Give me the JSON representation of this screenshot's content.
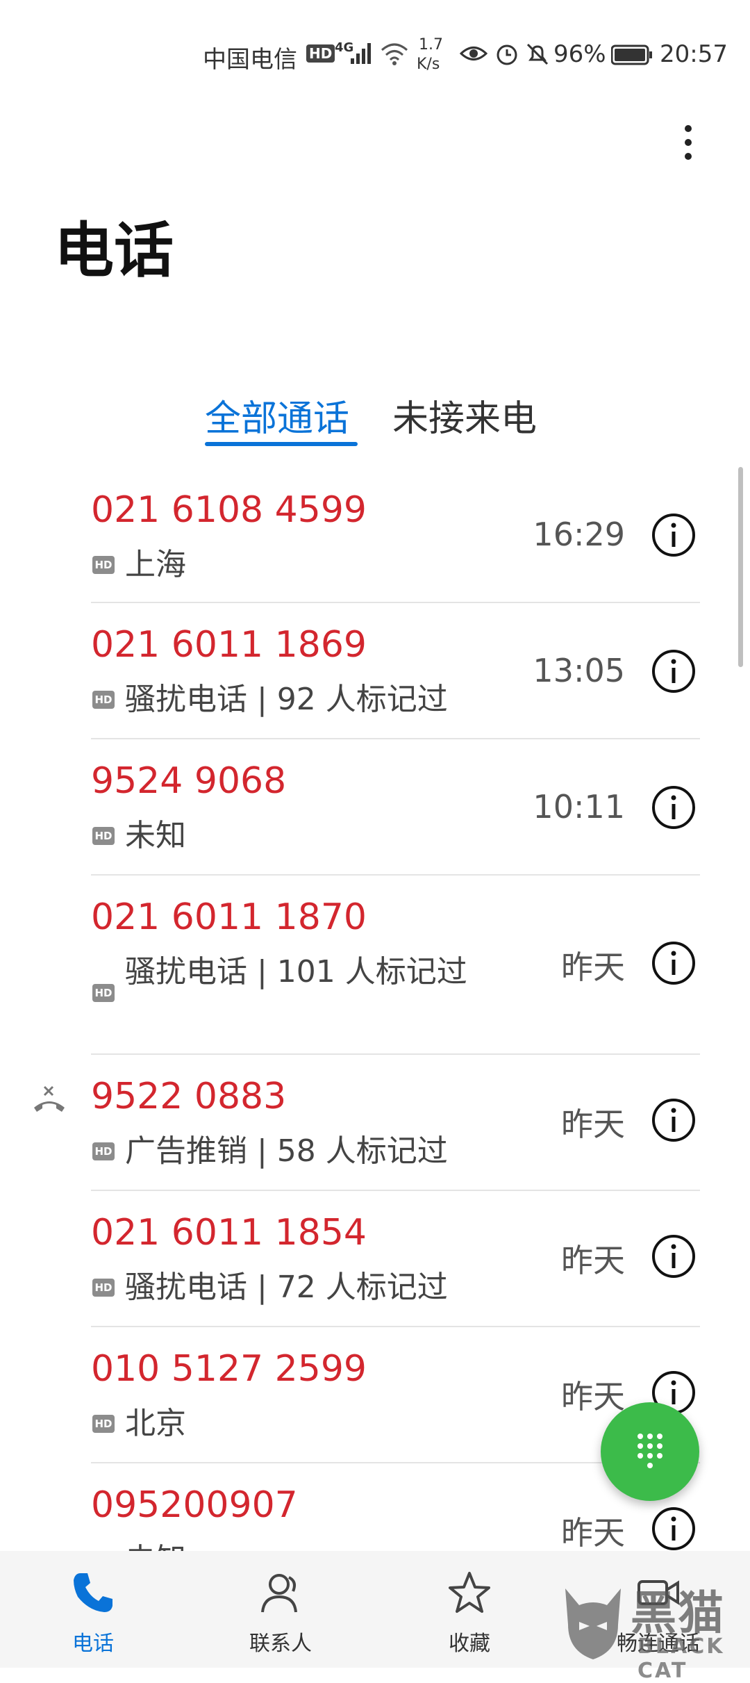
{
  "status_bar": {
    "carrier": "中国电信",
    "hd": "HD",
    "network": "4G",
    "speed_value": "1.7",
    "speed_unit": "K/s",
    "battery": "96%",
    "time": "20:57"
  },
  "header": {
    "title": "电话"
  },
  "tabs": [
    {
      "label": "全部通话",
      "active": true
    },
    {
      "label": "未接来电",
      "active": false
    }
  ],
  "calls": [
    {
      "number": "021 6108 4599",
      "hd": "HD",
      "desc": "上海",
      "time": "16:29",
      "missed": false
    },
    {
      "number": "021 6011 1869",
      "hd": "HD",
      "desc": "骚扰电话 | 92 人标记过",
      "time": "13:05",
      "missed": false
    },
    {
      "number": "9524 9068",
      "hd": "HD",
      "desc": "未知",
      "time": "10:11",
      "missed": false
    },
    {
      "number": "021 6011 1870",
      "hd": "HD",
      "desc": "骚扰电话 | 101 人标记过",
      "time": "昨天",
      "missed": false
    },
    {
      "number": "9522 0883",
      "hd": "HD",
      "desc": "广告推销 | 58 人标记过",
      "time": "昨天",
      "missed": true
    },
    {
      "number": "021 6011 1854",
      "hd": "HD",
      "desc": "骚扰电话 | 72 人标记过",
      "time": "昨天",
      "missed": false
    },
    {
      "number": "010 5127 2599",
      "hd": "HD",
      "desc": "北京",
      "time": "昨天",
      "missed": false
    },
    {
      "number": "095200907",
      "hd": "HD",
      "desc": "未知",
      "time": "昨天",
      "missed": false
    }
  ],
  "bottom_nav": [
    {
      "label": "电话",
      "icon": "phone-icon",
      "active": true
    },
    {
      "label": "联系人",
      "icon": "contacts-icon",
      "active": false
    },
    {
      "label": "收藏",
      "icon": "star-icon",
      "active": false
    },
    {
      "label": "畅连通话",
      "icon": "video-call-icon",
      "active": false
    }
  ],
  "watermark": {
    "cn": "黑猫",
    "en": "BLACK CAT"
  },
  "colors": {
    "accent": "#0a73d8",
    "missed": "#d3262e",
    "fab": "#3cbb4a"
  }
}
